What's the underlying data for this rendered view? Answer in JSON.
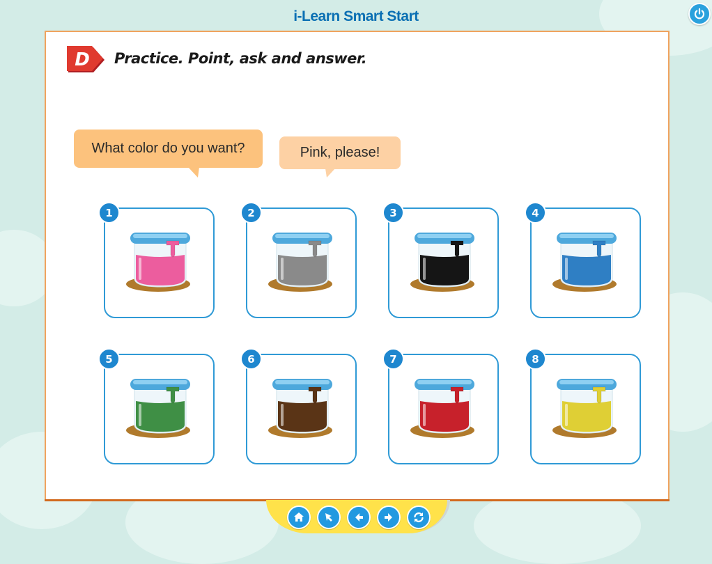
{
  "app": {
    "title": "i-Learn Smart Start"
  },
  "exercise": {
    "badge": "D",
    "instruction": "Practice. Point, ask and answer.",
    "question": "What color do you want?",
    "answer": "Pink, please!"
  },
  "paints": [
    {
      "number": "1",
      "color": "#ec5d9e"
    },
    {
      "number": "2",
      "color": "#8a8a8a"
    },
    {
      "number": "3",
      "color": "#151515"
    },
    {
      "number": "4",
      "color": "#2f7fc4"
    },
    {
      "number": "5",
      "color": "#3f8f45"
    },
    {
      "number": "6",
      "color": "#5a3416"
    },
    {
      "number": "7",
      "color": "#c7212b"
    },
    {
      "number": "8",
      "color": "#dfcf35"
    }
  ],
  "nav": [
    "home-icon",
    "pointer-icon",
    "arrow-left-icon",
    "arrow-right-icon",
    "refresh-icon"
  ],
  "colors": {
    "accent": "#2299e0",
    "page_border": "#f0a35e",
    "nav_bar": "#ffe24a",
    "background": "#d3ece7"
  }
}
